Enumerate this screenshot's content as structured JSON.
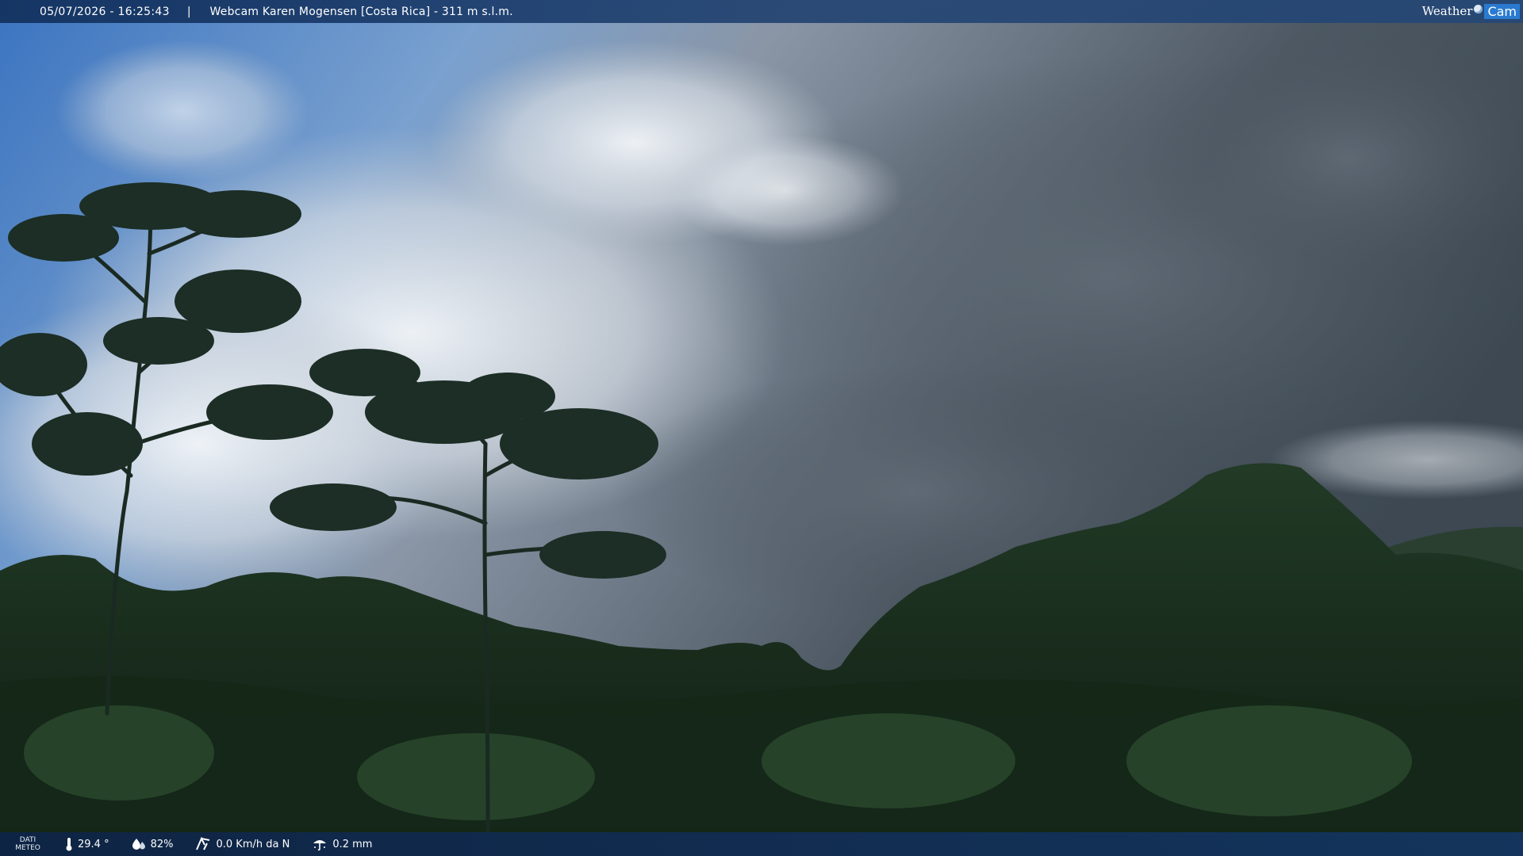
{
  "header": {
    "timestamp": "05/07/2026 - 16:25:43",
    "separator": "|",
    "title": "Webcam Karen Mogensen [Costa Rica]  - 311 m s.l.m."
  },
  "brand": {
    "part1": "Weather",
    "part2": "Cam"
  },
  "footer": {
    "label_line1": "DATI",
    "label_line2": "METEO",
    "temperature": "29.4 °",
    "humidity": "82%",
    "wind": "0.0 Km/h da N",
    "rain": "0.2 mm"
  },
  "colors": {
    "sky_blue": "#3f78c2",
    "storm_gray": "#4a5560",
    "foliage": "#1c3320",
    "bar": "#173a6e"
  },
  "icons": [
    "thermometer-icon",
    "humidity-drop-icon",
    "wind-icon",
    "rain-icon"
  ]
}
